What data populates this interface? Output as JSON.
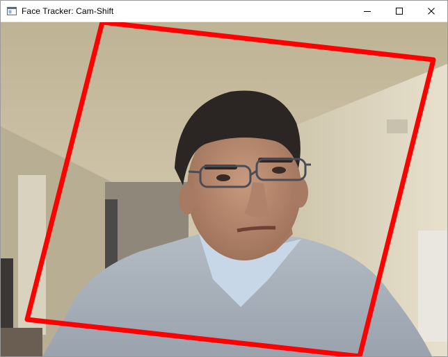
{
  "window": {
    "title": "Face Tracker: Cam-Shift",
    "controls": {
      "minimize": "minimize-icon",
      "maximize": "maximize-icon",
      "close": "close-icon"
    }
  },
  "tracker": {
    "box_color": "#ff0000",
    "shape": "rotated-rectangle"
  },
  "colors": {
    "ceiling": "#cfc3a8",
    "wall": "#d8cfb8",
    "sweater": "#a9b2bb",
    "shirt": "#c7d7e8",
    "skin": "#b88a6f",
    "hair": "#2b2524"
  }
}
